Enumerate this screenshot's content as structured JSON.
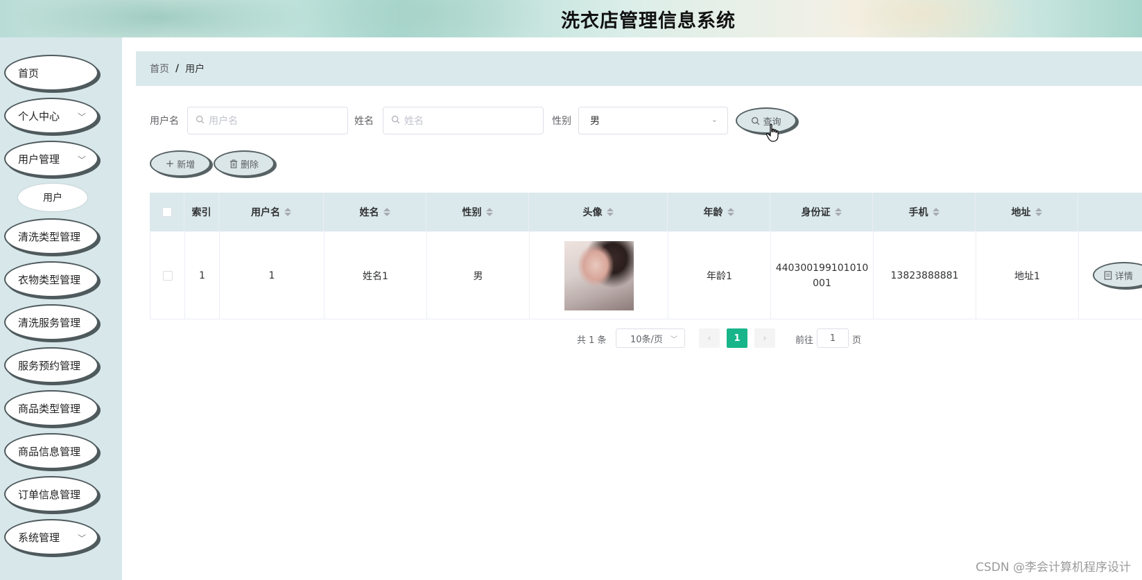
{
  "header": {
    "title": "洗衣店管理信息系统"
  },
  "sidebar": {
    "items": [
      {
        "label": "首页",
        "has_children": false
      },
      {
        "label": "个人中心",
        "has_children": true
      },
      {
        "label": "用户管理",
        "has_children": true,
        "expanded": true,
        "children": [
          {
            "label": "用户"
          }
        ]
      },
      {
        "label": "清洗类型管理",
        "has_children": false
      },
      {
        "label": "衣物类型管理",
        "has_children": false
      },
      {
        "label": "清洗服务管理",
        "has_children": false
      },
      {
        "label": "服务预约管理",
        "has_children": false
      },
      {
        "label": "商品类型管理",
        "has_children": false
      },
      {
        "label": "商品信息管理",
        "has_children": false
      },
      {
        "label": "订单信息管理",
        "has_children": false
      },
      {
        "label": "系统管理",
        "has_children": true
      }
    ]
  },
  "breadcrumb": {
    "home": "首页",
    "separator": "/",
    "current": "用户"
  },
  "search": {
    "username_label": "用户名",
    "username_placeholder": "用户名",
    "name_label": "姓名",
    "name_placeholder": "姓名",
    "gender_label": "性别",
    "gender_value": "男",
    "query_button": "查询"
  },
  "actions": {
    "add_button": "新增",
    "delete_button": "删除"
  },
  "table": {
    "columns": [
      "索引",
      "用户名",
      "姓名",
      "性别",
      "头像",
      "年龄",
      "身份证",
      "手机",
      "地址"
    ],
    "rows": [
      {
        "index": "1",
        "username": "1",
        "name": "姓名1",
        "gender": "男",
        "age": "年龄1",
        "id_card_line1": "440300199101010",
        "id_card_line2": "001",
        "phone": "13823888881",
        "address": "地址1",
        "detail_button": "详情"
      }
    ]
  },
  "pagination": {
    "total_text": "共 1 条",
    "page_size": "10条/页",
    "current_page": "1",
    "goto_prefix": "前往",
    "goto_value": "1",
    "goto_suffix": "页"
  },
  "watermark": "CSDN @李会计算机程序设计",
  "colors": {
    "accent": "#18b58a",
    "sidebar_bg": "#d7e7ea",
    "header_bg": "#dbe9ec"
  }
}
